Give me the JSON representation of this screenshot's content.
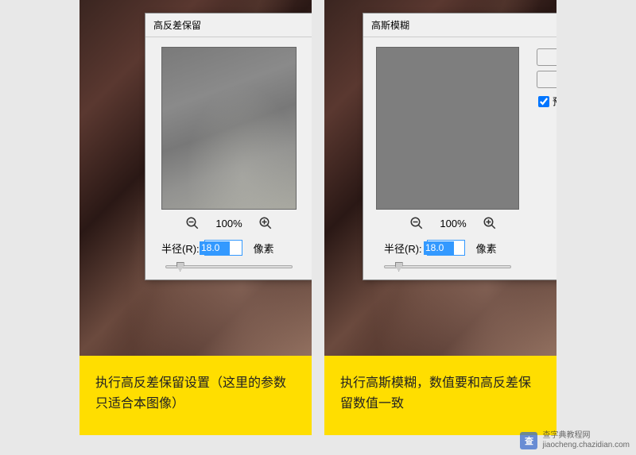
{
  "panels": {
    "left": {
      "dialog_title": "高反差保留",
      "zoom_percent": "100%",
      "radius_label": "半径(R):",
      "radius_value": "18.0",
      "unit": "像素",
      "caption": "执行高反差保留设置（这里的参数只适合本图像）"
    },
    "right": {
      "dialog_title": "高斯模糊",
      "zoom_percent": "100%",
      "radius_label": "半径(R):",
      "radius_value": "18.0",
      "unit": "像素",
      "preview_check": "预",
      "caption": "执行高斯模糊，数值要和高反差保留数值一致"
    }
  },
  "watermark": {
    "logo": "查",
    "line1": "查字典教程网",
    "line2": "jiaocheng.chazidian.com"
  }
}
